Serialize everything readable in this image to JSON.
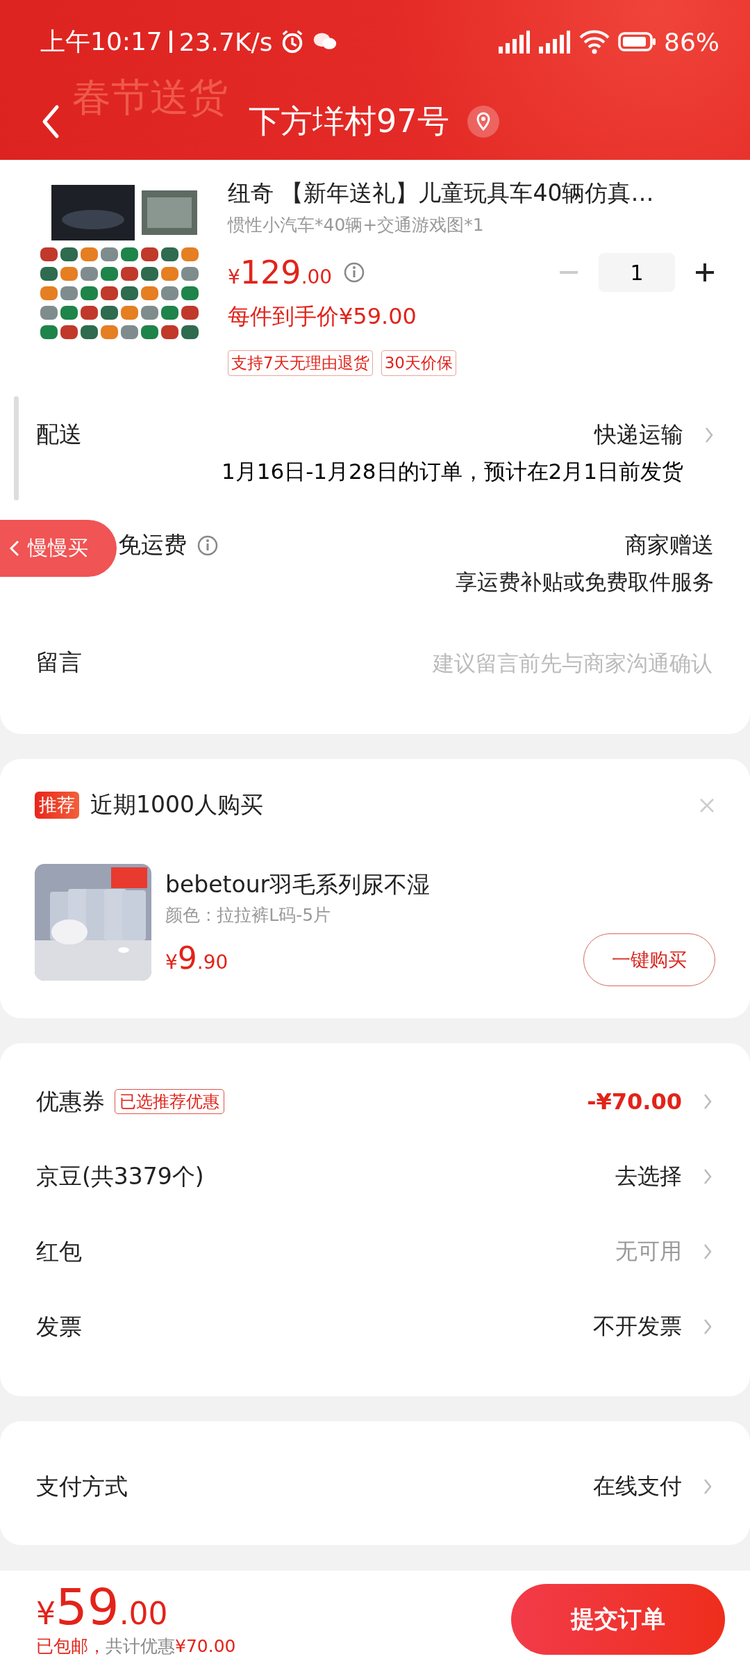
{
  "status_bar": {
    "time": "上午10:17",
    "speed": "23.7K/s",
    "battery": "86%"
  },
  "header": {
    "decoration": "春节送货",
    "title": "下方垟村97号"
  },
  "product": {
    "title": "纽奇 【新年送礼】儿童玩具车40辆仿真…",
    "spec": "惯性小汽车*40辆+交通游戏图*1",
    "price_symbol": "¥",
    "price_int": "129",
    "price_dec": ".00",
    "quantity": "1",
    "final_price": "每件到手价¥59.00",
    "tags": [
      "支持7天无理由退货",
      "30天价保"
    ]
  },
  "delivery": {
    "label": "配送",
    "value": "快递运输",
    "note": "1月16日-1月28日的订单，预计在2月1日前发货"
  },
  "free_shipping": {
    "label": "免运费",
    "value": "商家赠送",
    "note": "享运费补贴或免费取件服务"
  },
  "message": {
    "label": "留言",
    "placeholder": "建议留言前先与商家沟通确认"
  },
  "floating_tab": {
    "label": "慢慢买"
  },
  "recommend": {
    "badge": "推荐",
    "title": "近期1000人购买",
    "item": {
      "name": "bebetour羽毛系列尿不湿",
      "spec": "颜色 : 拉拉裤L码-5片",
      "price_symbol": "¥",
      "price_int": "9",
      "price_dec": ".90",
      "button": "一键购买"
    }
  },
  "discounts": [
    {
      "label": "优惠券",
      "tag": "已选推荐优惠",
      "value": "-¥70.00",
      "kind": "highlight"
    },
    {
      "label": "京豆(共3379个)",
      "value": "去选择",
      "kind": "normal"
    },
    {
      "label": "红包",
      "value": "无可用",
      "kind": "muted"
    },
    {
      "label": "发票",
      "value": "不开发票",
      "kind": "normal"
    }
  ],
  "payment": {
    "label": "支付方式",
    "value": "在线支付"
  },
  "footer": {
    "price_symbol": "¥",
    "price_int": "59",
    "price_dec": ".00",
    "shipping": "已包邮，",
    "saving_label": "共计优惠",
    "saving_amount": "¥70.00",
    "submit": "提交订单"
  }
}
